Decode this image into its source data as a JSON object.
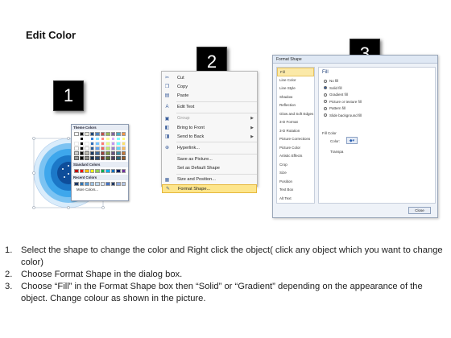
{
  "title": "Edit Color",
  "badges": [
    "1",
    "2",
    "3"
  ],
  "context_menu": {
    "items": [
      {
        "label": "Cut",
        "icon": "scissors-icon",
        "glyph": "✂",
        "disabled": false,
        "submenu": false
      },
      {
        "label": "Copy",
        "icon": "copy-icon",
        "glyph": "❐",
        "disabled": false,
        "submenu": false
      },
      {
        "label": "Paste",
        "icon": "paste-icon",
        "glyph": "▤",
        "disabled": false,
        "submenu": false
      },
      {
        "label": "Edit Text",
        "icon": "edit-text-icon",
        "glyph": "A",
        "disabled": false,
        "submenu": false
      },
      {
        "label": "Group",
        "icon": "group-icon",
        "glyph": "▣",
        "disabled": true,
        "submenu": true
      },
      {
        "label": "Bring to Front",
        "icon": "bring-front-icon",
        "glyph": "◧",
        "disabled": false,
        "submenu": true
      },
      {
        "label": "Send to Back",
        "icon": "send-back-icon",
        "glyph": "◨",
        "disabled": false,
        "submenu": true
      },
      {
        "label": "Hyperlink...",
        "icon": "hyperlink-icon",
        "glyph": "⊕",
        "disabled": false,
        "submenu": false
      },
      {
        "label": "Save as Picture...",
        "icon": "",
        "glyph": "",
        "disabled": false,
        "submenu": false
      },
      {
        "label": "Set as Default Shape",
        "icon": "",
        "glyph": "",
        "disabled": false,
        "submenu": false
      },
      {
        "label": "Size and Position...",
        "icon": "size-icon",
        "glyph": "▦",
        "disabled": false,
        "submenu": false
      },
      {
        "label": "Format Shape...",
        "icon": "format-shape-icon",
        "glyph": "✎",
        "disabled": false,
        "submenu": false
      }
    ]
  },
  "dialog": {
    "title": "Format Shape",
    "categories": [
      "Fill",
      "Line Color",
      "Line Style",
      "Shadow",
      "Reflection",
      "Glow and Soft Edges",
      "3-D Format",
      "3-D Rotation",
      "Picture Corrections",
      "Picture Color",
      "Artistic Effects",
      "Crop",
      "Size",
      "Position",
      "Text Box",
      "Alt Text"
    ],
    "fill_heading": "Fill",
    "fill_options": [
      "No fill",
      "Solid fill",
      "Gradient fill",
      "Picture or texture fill",
      "Pattern fill",
      "Slide background fill"
    ],
    "fill_color_label": "Fill Color",
    "color_label": "Color:",
    "transparency_label": "Transpa",
    "palette": {
      "theme_heading": "Theme Colors",
      "standard_heading": "Standard Colors",
      "recent_heading": "Recent Colors",
      "more_colors": "More Colors...",
      "theme_row": [
        "#ffffff",
        "#000000",
        "#eeece1",
        "#1f497d",
        "#4f81bd",
        "#c0504d",
        "#9bbb59",
        "#8064a2",
        "#4bacc6",
        "#f79646"
      ],
      "standard_row": [
        "#c00000",
        "#ff0000",
        "#ffc000",
        "#ffff00",
        "#92d050",
        "#00b050",
        "#00b0f0",
        "#0070c0",
        "#002060",
        "#7030a0"
      ],
      "recent_row": [
        "#1f3864",
        "#2e75b6",
        "#5b9bd5",
        "#9dc3e6",
        "#bdd7ee",
        "#deebf7",
        "#4472c4",
        "#203864",
        "#8faadc",
        "#b4c7e7"
      ]
    },
    "close_label": "Close"
  },
  "instructions": [
    {
      "num": "1.",
      "text": "Select the shape to change the color and Right click the object( click any object which you want to change color)"
    },
    {
      "num": "2.",
      "text": "Choose Format Shape in the dialog box."
    },
    {
      "num": "3.",
      "text": "Choose “Fill” in the Format Shape box then “Solid” or “Gradient” depending on the appearance of the object. Change colour as shown in the picture."
    }
  ]
}
